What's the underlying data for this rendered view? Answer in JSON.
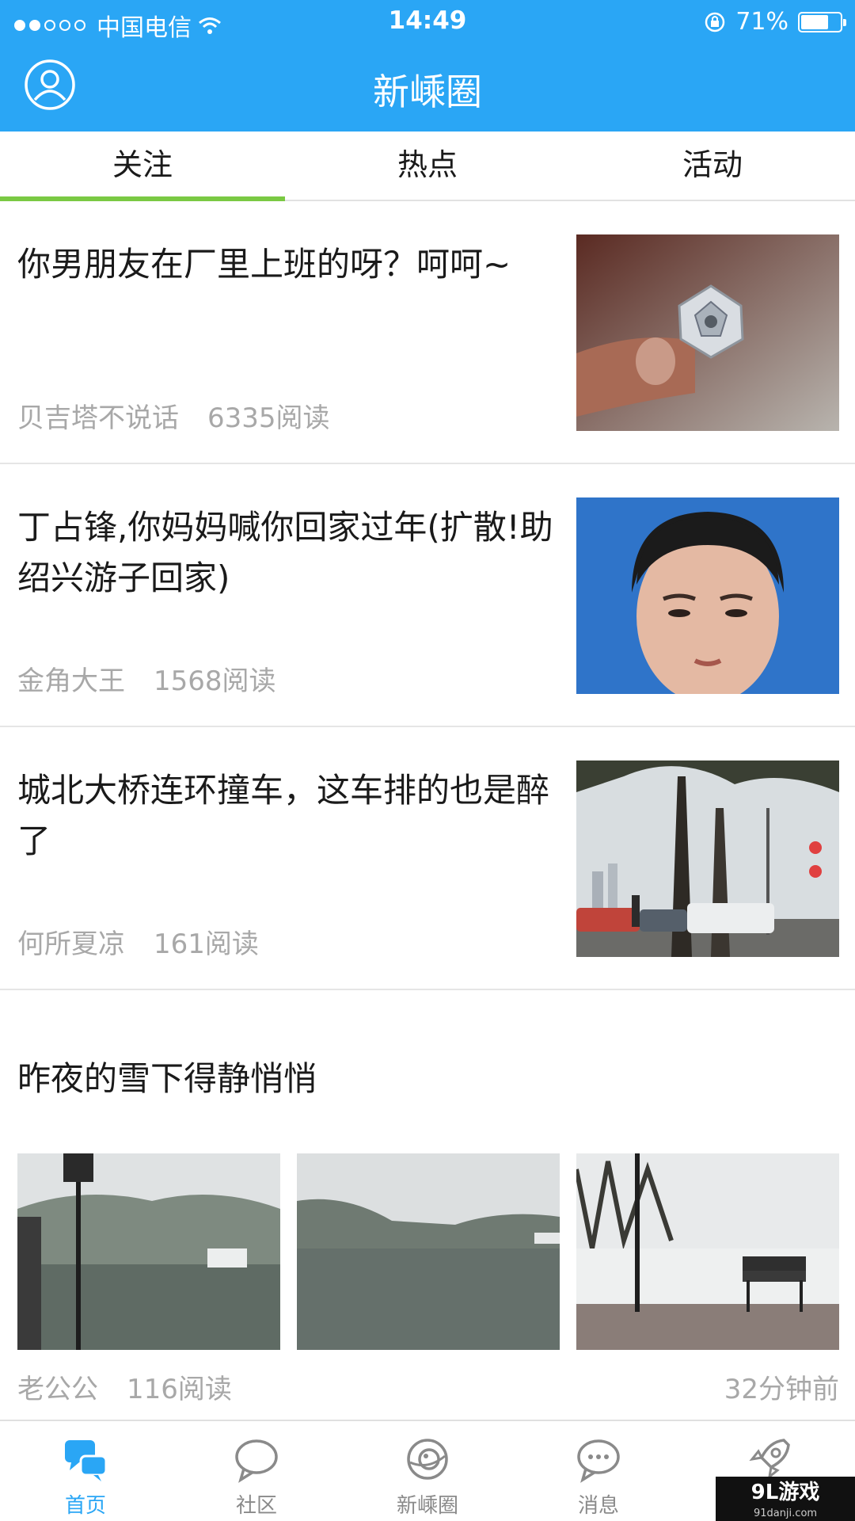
{
  "status_bar": {
    "carrier": "中国电信",
    "time": "14:49",
    "battery": "71%",
    "battery_level": 0.71
  },
  "header": {
    "title": "新嵊圈"
  },
  "tabs": [
    {
      "label": "关注",
      "active": true
    },
    {
      "label": "热点",
      "active": false
    },
    {
      "label": "活动",
      "active": false
    }
  ],
  "feed": [
    {
      "title": "你男朋友在厂里上班的呀？呵呵~",
      "author": "贝吉塔不说话",
      "reads": "6335阅读"
    },
    {
      "title": "丁占锋,你妈妈喊你回家过年(扩散!助绍兴游子回家)",
      "author": "金角大王",
      "reads": "1568阅读"
    },
    {
      "title": "城北大桥连环撞车，这车排的也是醉了",
      "author": "何所夏凉",
      "reads": "161阅读"
    }
  ],
  "gallery_post": {
    "title": "昨夜的雪下得静悄悄",
    "author": "老公公",
    "reads": "116阅读",
    "time_ago": "32分钟前"
  },
  "bottom_nav": [
    {
      "label": "首页",
      "icon": "chat-bubbles-icon",
      "active": true
    },
    {
      "label": "社区",
      "icon": "speech-bubble-icon",
      "active": false
    },
    {
      "label": "新嵊圈",
      "icon": "planet-icon",
      "active": false
    },
    {
      "label": "消息",
      "icon": "message-dots-icon",
      "active": false
    },
    {
      "label": "",
      "icon": "rocket-icon",
      "active": false
    }
  ],
  "watermark": {
    "text": "9L游戏",
    "url": "91danji.com"
  },
  "colors": {
    "brand": "#2aa6f5",
    "tab_indicator": "#7ac943",
    "meta_text": "#a8a8a8"
  }
}
